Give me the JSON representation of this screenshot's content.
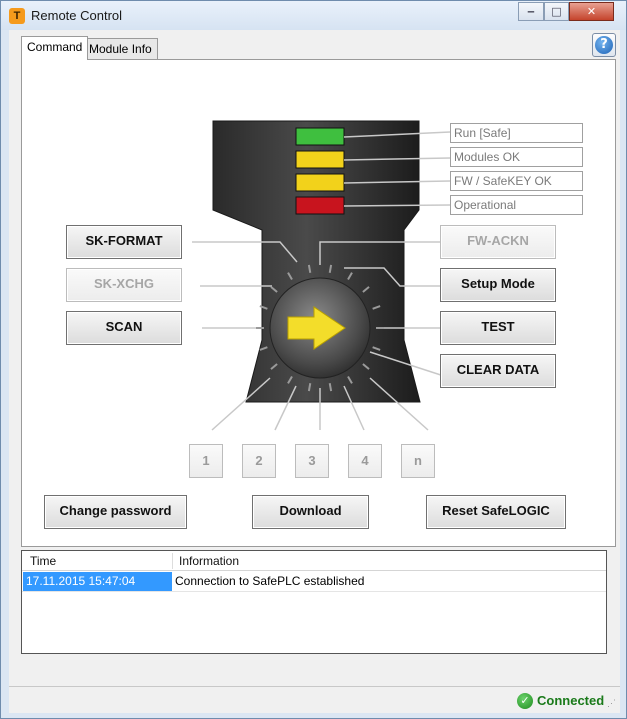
{
  "window": {
    "title": "Remote Control",
    "app_icon": "safelogic-logo-icon",
    "controls": {
      "minimize": "‒",
      "maximize": "□",
      "close": "✕"
    }
  },
  "tabs": [
    {
      "label": "Command",
      "active": true
    },
    {
      "label": "Module Info",
      "active": false
    }
  ],
  "help": {
    "icon": "help-icon",
    "glyph": "?"
  },
  "status_indicators": [
    {
      "label": "Run [Safe]",
      "led_color": "#3fbf3f"
    },
    {
      "label": "Modules OK",
      "led_color": "#f2d21b"
    },
    {
      "label": "FW / SafeKEY OK",
      "led_color": "#f2d21b"
    },
    {
      "label": "Operational",
      "led_color": "#c8141e"
    }
  ],
  "commands": {
    "sk_format": "SK-FORMAT",
    "sk_xchg": "SK-XCHG",
    "scan": "SCAN",
    "fw_ackn": "FW-ACKN",
    "setup_mode": "Setup Mode",
    "test": "TEST",
    "clear_data": "CLEAR DATA"
  },
  "module_buttons": [
    "1",
    "2",
    "3",
    "4",
    "n"
  ],
  "actions": {
    "change_password": "Change password",
    "download": "Download",
    "reset": "Reset SafeLOGIC"
  },
  "log": {
    "columns": [
      "Time",
      "Information"
    ],
    "rows": [
      {
        "time": "17.11.2015 15:47:04",
        "info": "Connection to SafePLC established"
      }
    ]
  },
  "status_bar": {
    "text": "Connected",
    "icon": "check-circle-icon",
    "color": "#1a7a1a"
  }
}
